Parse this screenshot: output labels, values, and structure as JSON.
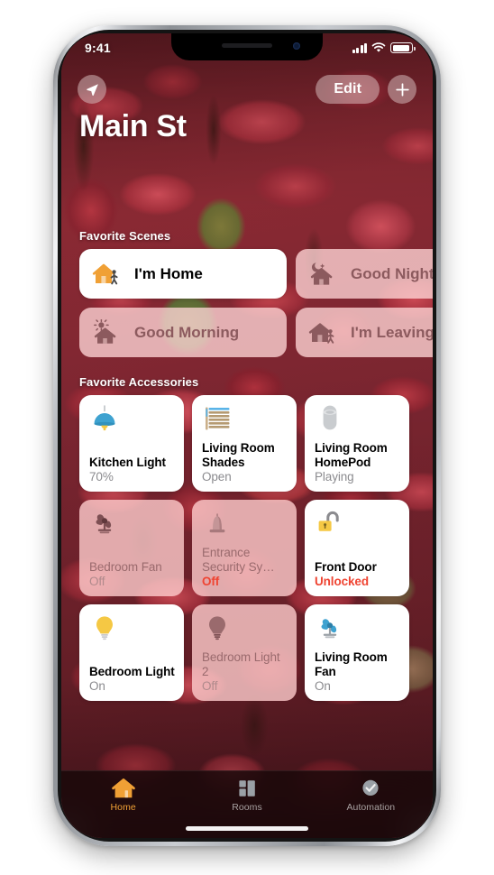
{
  "statusbar": {
    "time": "9:41",
    "cellular_icon": "signal-bars-icon",
    "wifi_icon": "wifi-icon",
    "battery_icon": "battery-icon"
  },
  "nav": {
    "location_icon": "location-arrow-icon",
    "edit_label": "Edit",
    "add_icon": "plus-icon"
  },
  "header": {
    "title": "Main St"
  },
  "scenes": {
    "section_label": "Favorite Scenes",
    "items": [
      {
        "name": "I'm Home",
        "icon": "house-person-icon",
        "state": "active"
      },
      {
        "name": "Good Night",
        "icon": "moon-house-icon",
        "state": "inactive"
      },
      {
        "name": "Good Morning",
        "icon": "sun-house-icon",
        "state": "inactive"
      },
      {
        "name": "I'm Leaving",
        "icon": "house-walk-icon",
        "state": "inactive"
      }
    ]
  },
  "accessories": {
    "section_label": "Favorite Accessories",
    "items": [
      {
        "name": "Kitchen Light",
        "status": "70%",
        "icon": "pendant-lamp-icon",
        "state": "on",
        "alert": false
      },
      {
        "name": "Living Room Shades",
        "status": "Open",
        "icon": "window-blinds-icon",
        "state": "on",
        "alert": false
      },
      {
        "name": "Living Room HomePod",
        "status": "Playing",
        "icon": "homepod-icon",
        "state": "on",
        "alert": false
      },
      {
        "name": "Bedroom Fan",
        "status": "Off",
        "icon": "fan-icon",
        "state": "off",
        "alert": false
      },
      {
        "name": "Entrance Security Sy…",
        "status": "Off",
        "icon": "siren-icon",
        "state": "off",
        "alert": true
      },
      {
        "name": "Front Door",
        "status": "Unlocked",
        "icon": "unlocked-lock-icon",
        "state": "on",
        "alert": true
      },
      {
        "name": "Bedroom Light",
        "status": "On",
        "icon": "bulb-icon",
        "state": "on",
        "alert": false
      },
      {
        "name": "Bedroom Light 2",
        "status": "Off",
        "icon": "bulb-icon",
        "state": "off",
        "alert": false
      },
      {
        "name": "Living Room Fan",
        "status": "On",
        "icon": "fan-icon",
        "state": "on",
        "alert": false
      }
    ]
  },
  "tabbar": {
    "tabs": [
      {
        "label": "Home",
        "icon": "house-icon",
        "active": true
      },
      {
        "label": "Rooms",
        "icon": "rooms-grid-icon",
        "active": false
      },
      {
        "label": "Automation",
        "icon": "clock-check-icon",
        "active": false
      }
    ]
  },
  "colors": {
    "accent": "#f0a035",
    "alert": "#ef4432",
    "card_on": "#ffffff",
    "card_off": "#ffcdcd",
    "tabbar": "#160809"
  }
}
